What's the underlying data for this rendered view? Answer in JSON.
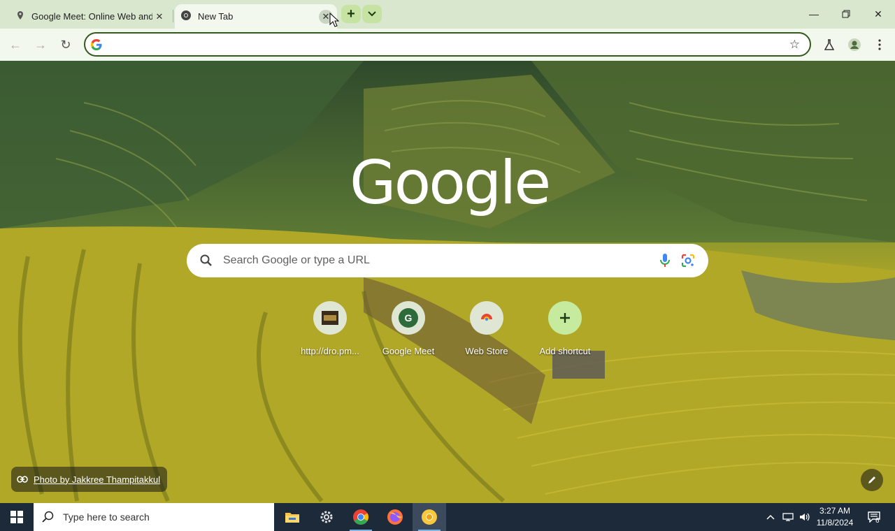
{
  "tabs": [
    {
      "title": "Google Meet: Online Web and",
      "active": false
    },
    {
      "title": "New Tab",
      "active": true
    }
  ],
  "toolbar": {
    "omnibox_value": "",
    "omnibox_placeholder": ""
  },
  "ntp": {
    "logo_text": "Google",
    "search_placeholder": "Search Google or type a URL",
    "shortcuts": [
      {
        "label": "http://dro.pm...",
        "icon": "site-thumbnail-icon"
      },
      {
        "label": "Google Meet",
        "icon": "letter-g-icon",
        "letter": "G"
      },
      {
        "label": "Web Store",
        "icon": "chrome-web-store-icon"
      },
      {
        "label": "Add shortcut",
        "icon": "plus-icon"
      }
    ],
    "photo_credit": "Photo by Jakkree Thampitakkul"
  },
  "taskbar": {
    "search_placeholder": "Type here to search",
    "time": "3:27 AM",
    "date": "11/8/2024",
    "notification_count": "6"
  },
  "colors": {
    "tabstrip": "#d9e7cf",
    "toolbar": "#f3f8ee",
    "accent": "#34591f",
    "taskbar": "#1c2a3a"
  }
}
